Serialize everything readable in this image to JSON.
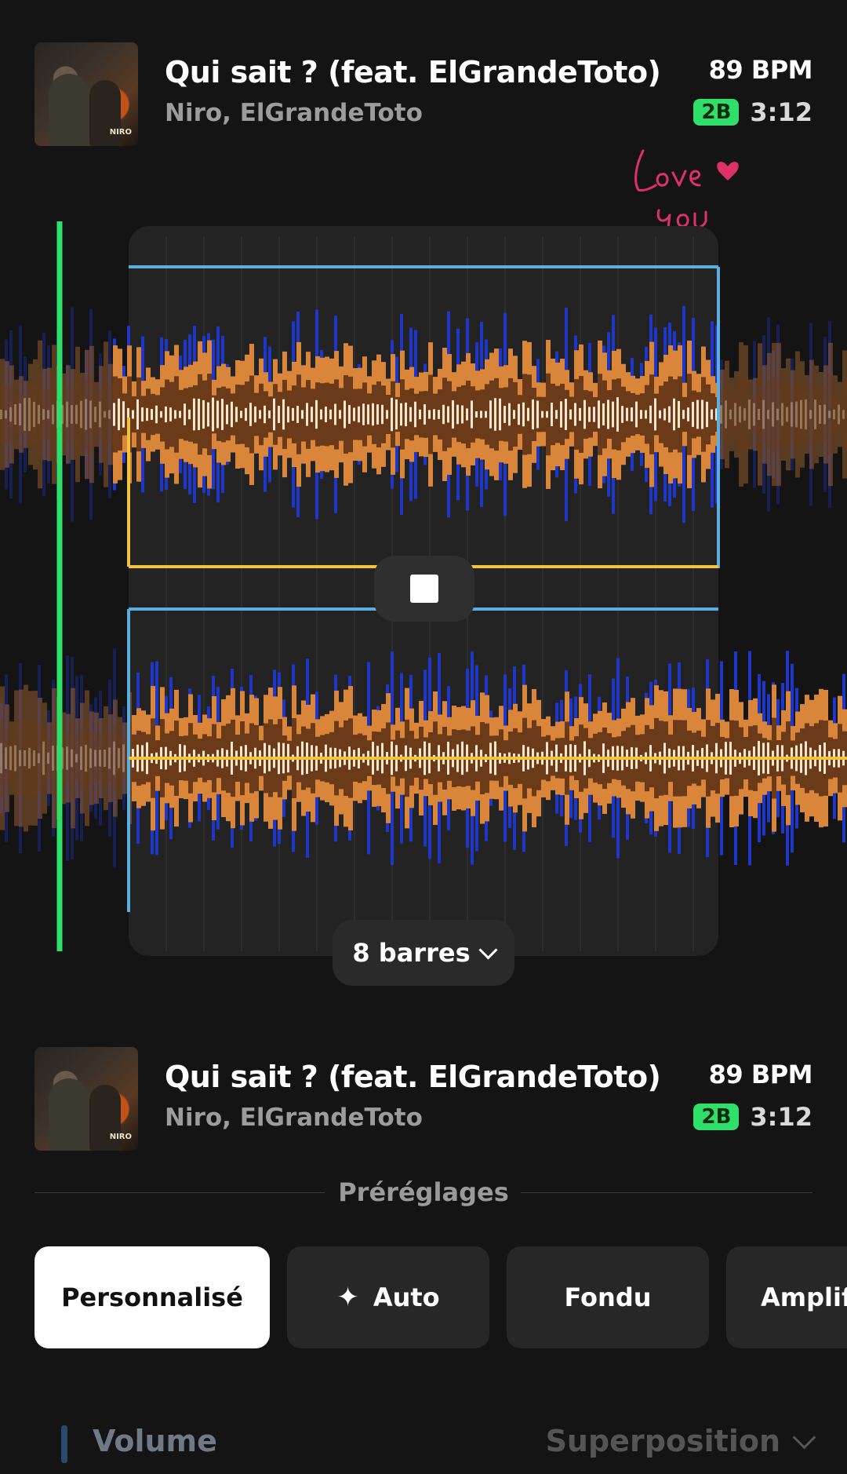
{
  "track_top": {
    "title": "Qui sait ? (feat. ElGrandeToto)",
    "artist": "Niro, ElGrandeToto",
    "bpm": "89 BPM",
    "key": "2B",
    "duration": "3:12"
  },
  "sticker": {
    "text": "Love you"
  },
  "transport": {
    "stop_icon": "stop-icon"
  },
  "loop": {
    "label": "8 barres"
  },
  "track_bottom": {
    "title": "Qui sait ? (feat. ElGrandeToto)",
    "artist": "Niro, ElGrandeToto",
    "bpm": "89 BPM",
    "key": "2B",
    "duration": "3:12"
  },
  "presets": {
    "header": "Préréglages",
    "items": [
      {
        "label": "Personnalisé",
        "active": true
      },
      {
        "label": "Auto",
        "icon": "sparkle-icon"
      },
      {
        "label": "Fondu"
      },
      {
        "label": "Amplif"
      }
    ]
  },
  "controls": {
    "volume_label": "Volume",
    "mode_label": "Superposition"
  },
  "colors": {
    "key_badge": "#2ee06a",
    "playhead": "#2ee06a",
    "wave_orange": "#d9853a",
    "wave_brown": "#6b3a18",
    "wave_blue": "#1f37c8",
    "wave_cream": "#f5e6cc",
    "guide_blue": "#5aaee0",
    "guide_yellow": "#f2c43a"
  }
}
